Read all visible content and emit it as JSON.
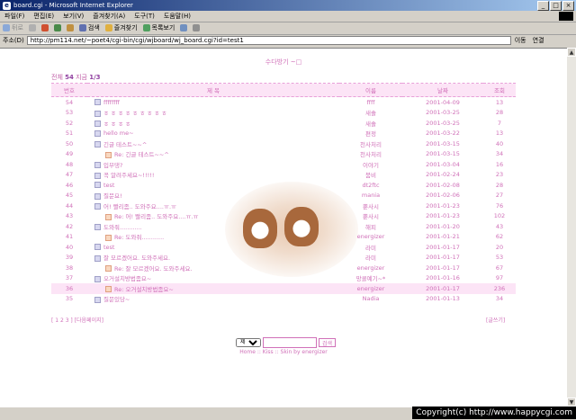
{
  "window": {
    "title": "board.cgi - Microsoft Internet Explorer"
  },
  "menu": [
    "파일(F)",
    "편집(E)",
    "보기(V)",
    "즐겨찾기(A)",
    "도구(T)",
    "도움말(H)"
  ],
  "toolbar": {
    "back": "뒤로",
    "search": "검색",
    "favorites": "즐겨찾기",
    "history": "목록보기"
  },
  "address": {
    "label": "주소(D)",
    "url": "http://pm114.net/~poet4/cgi-bin/cgi/wjboard/wj_board.cgi?id=test1",
    "go": "이동",
    "links": "연결"
  },
  "board": {
    "heading": "수다방기 ~□",
    "summary_prefix": "전체",
    "total": "54",
    "summary_mid": "지금",
    "page": "1/3",
    "columns": {
      "num": "번호",
      "subject": "제  목",
      "name": "이름",
      "date": "날짜",
      "hits": "조회"
    },
    "rows": [
      {
        "num": "54",
        "subject": "ffffffff",
        "name": "ffff",
        "date": "2001-04-09",
        "hits": "13",
        "reply": false
      },
      {
        "num": "53",
        "subject": "ㅎ ㅎ ㅎ ㅎ ㅎ ㅎ ㅎ ㅎ ㅎ",
        "name": "새솔",
        "date": "2001-03-25",
        "hits": "28",
        "reply": false
      },
      {
        "num": "52",
        "subject": "ㅎ ㅎ ㅎ ㅎ",
        "name": "새솔",
        "date": "2001-03-25",
        "hits": "7",
        "reply": false
      },
      {
        "num": "51",
        "subject": "hello me~",
        "name": "편정",
        "date": "2001-03-22",
        "hits": "13",
        "reply": false
      },
      {
        "num": "50",
        "subject": "긴글 테스트~~^",
        "name": "천사처리",
        "date": "2001-03-15",
        "hits": "40",
        "reply": false
      },
      {
        "num": "49",
        "subject": "Re: 긴글 테스트~~^",
        "name": "천사처리",
        "date": "2001-03-15",
        "hits": "34",
        "reply": true
      },
      {
        "num": "48",
        "subject": "입부댕?",
        "name": "이야기",
        "date": "2001-03-04",
        "hits": "16",
        "reply": false
      },
      {
        "num": "47",
        "subject": "꼭 알려주세요~!!!!!",
        "name": "붐비",
        "date": "2001-02-24",
        "hits": "23",
        "reply": false
      },
      {
        "num": "46",
        "subject": "test",
        "name": "dt2ftc",
        "date": "2001-02-08",
        "hits": "28",
        "reply": false
      },
      {
        "num": "45",
        "subject": "질문요!",
        "name": "mania",
        "date": "2001-02-06",
        "hits": "27",
        "reply": false
      },
      {
        "num": "44",
        "subject": "어! 빨리좀.. 도와주요....ㅠ.ㅠ",
        "name": "뿐사시",
        "date": "2001-01-23",
        "hits": "76",
        "reply": false
      },
      {
        "num": "43",
        "subject": "Re: 어! 빨리좀.. 도와주요....ㅠ.ㅠ",
        "name": "뿐사시",
        "date": "2001-01-23",
        "hits": "102",
        "reply": true
      },
      {
        "num": "42",
        "subject": "도와줘............",
        "name": "해피",
        "date": "2001-01-20",
        "hits": "43",
        "reply": false
      },
      {
        "num": "41",
        "subject": "Re: 도와줘............",
        "name": "energizer",
        "date": "2001-01-21",
        "hits": "62",
        "reply": true
      },
      {
        "num": "40",
        "subject": "test",
        "name": "라미",
        "date": "2001-01-17",
        "hits": "20",
        "reply": false
      },
      {
        "num": "39",
        "subject": "잘 모르겠어요. 도와주세요.",
        "name": "라미",
        "date": "2001-01-17",
        "hits": "53",
        "reply": false
      },
      {
        "num": "38",
        "subject": "Re: 잘 모르겠어요. 도와주세요.",
        "name": "energizer",
        "date": "2001-01-17",
        "hits": "67",
        "reply": true
      },
      {
        "num": "37",
        "subject": "오거설치방법좀요~",
        "name": "망콜예기~*",
        "date": "2001-01-16",
        "hits": "97",
        "reply": false
      },
      {
        "num": "36",
        "subject": "Re: 오거설치방법좀요~",
        "name": "energizer",
        "date": "2001-01-17",
        "hits": "236",
        "reply": true,
        "highlight": true
      },
      {
        "num": "35",
        "subject": "질문있당~",
        "name": "Nadia",
        "date": "2001-01-13",
        "hits": "34",
        "reply": false
      }
    ],
    "pager_left": "[ 1 2 3 ]  [다음페이지]",
    "pager_right": "[글쓰기]",
    "search_option": "제목",
    "search_button": "검색",
    "footer": "Home :: Kiss :: Skin by energizer"
  },
  "copyright": "Copyright(c) http://www.happycgi.com"
}
